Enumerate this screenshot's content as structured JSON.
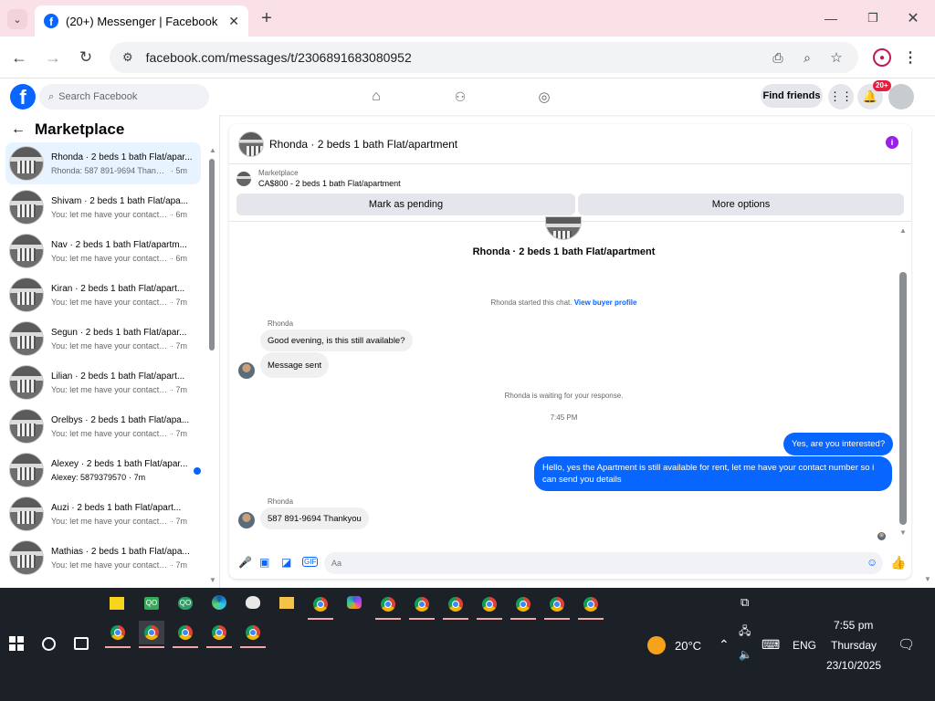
{
  "browser": {
    "tab_title": "(20+) Messenger | Facebook",
    "url": "facebook.com/messages/t/2306891683080952"
  },
  "fb": {
    "search_placeholder": "Search Facebook",
    "find_friends": "Find friends",
    "notif_badge": "20+"
  },
  "sidebar": {
    "title": "Marketplace",
    "conversations": [
      {
        "name": "Rhonda · 2 beds 1 bath Flat/apar...",
        "preview": "Rhonda: 587 891-9694 Thankyou",
        "time": "· 5m",
        "active": true
      },
      {
        "name": "Shivam · 2 beds 1 bath Flat/apa...",
        "preview": "You: let me have your contact nu...",
        "time": "· 6m"
      },
      {
        "name": "Nav · 2 beds 1 bath Flat/apartm...",
        "preview": "You: let me have your contact nu...",
        "time": "· 6m"
      },
      {
        "name": "Kiran · 2 beds 1 bath Flat/apart...",
        "preview": "You: let me have your contact nu...",
        "time": "· 7m"
      },
      {
        "name": "Segun · 2 beds 1 bath Flat/apar...",
        "preview": "You: let me have your contact nu...",
        "time": "· 7m"
      },
      {
        "name": "Lilian · 2 beds 1 bath Flat/apart...",
        "preview": "You: let me have your contact nu...",
        "time": "· 7m"
      },
      {
        "name": "Orelbys · 2 beds 1 bath Flat/apa...",
        "preview": "You: let me have your contact nu...",
        "time": "· 7m"
      },
      {
        "name": "Alexey · 2 beds 1 bath Flat/apar...",
        "preview": "Alexey: 5879379570",
        "time": "· 7m",
        "unread": true
      },
      {
        "name": "Auzi · 2 beds 1 bath Flat/apart...",
        "preview": "You: let me have your contact nu...",
        "time": "· 7m"
      },
      {
        "name": "Mathias · 2 beds 1 bath Flat/apa...",
        "preview": "You: let me have your contact nu...",
        "time": "· 7m"
      }
    ]
  },
  "chat": {
    "title": "Rhonda · 2 beds 1 bath Flat/apartment",
    "marketplace_label": "Marketplace",
    "listing": "CA$800 - 2 beds 1 bath Flat/apartment",
    "mark_pending": "Mark as pending",
    "more_options": "More options",
    "intro_title": "Rhonda · 2 beds 1 bath Flat/apartment",
    "started_text": "Rhonda started this chat.",
    "view_profile": "View buyer profile",
    "sender1": "Rhonda",
    "msg1": "Good evening, is this still available?",
    "msg2": "Message sent",
    "waiting": "Rhonda is waiting for your response.",
    "time_sep": "7:45 PM",
    "out1": "Yes, are you interested?",
    "out2": "Hello, yes the Apartment is still available for rent, let me have your contact number so i can send you details",
    "sender2": "Rhonda",
    "msg3": "587 891-9694 Thankyou",
    "input_placeholder": "Aa"
  },
  "taskbar": {
    "weather": "20°C",
    "lang": "ENG",
    "time": "7:55 pm",
    "day": "Thursday",
    "date": "23/10/2025"
  }
}
